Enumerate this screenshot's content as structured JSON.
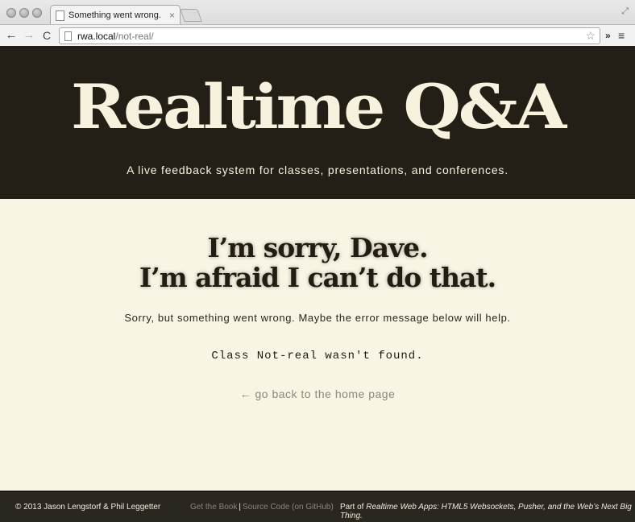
{
  "browser": {
    "tab_title": "Something went wrong.",
    "tab_close": "×",
    "url_host": "rwa.local",
    "url_path": "/not-real/",
    "nav": {
      "back": "←",
      "forward": "→",
      "reload": "C"
    },
    "star": "☆",
    "extensions": "»",
    "menu": "≡",
    "fullscreen": "⤢"
  },
  "header": {
    "title": "Realtime Q&A",
    "tagline": "A live feedback system for classes, presentations, and conferences."
  },
  "main": {
    "heading_line1": "I’m sorry, Dave.",
    "heading_line2": "I’m afraid I can’t do that.",
    "intro": "Sorry, but something went wrong. Maybe the error message below will help.",
    "error_message": "Class Not-real wasn't found.",
    "home_link": "← go back to the home page"
  },
  "footer": {
    "copyright": "© 2013 Jason Lengstorf & Phil Leggetter",
    "link_book": "Get the Book",
    "separator": "|",
    "link_source": "Source Code (on GitHub)",
    "part_of_prefix": "Part of ",
    "part_of_title": "Realtime Web Apps: HTML5 Websockets, Pusher, and the Web’s Next Big Thing."
  },
  "colors": {
    "header_bg": "#241f16",
    "page_bg": "#f8f5e4",
    "cream_text": "#f7f2de",
    "dark_text": "#221c12",
    "muted_link": "#8f877a",
    "footer_bg": "#2a2620"
  }
}
